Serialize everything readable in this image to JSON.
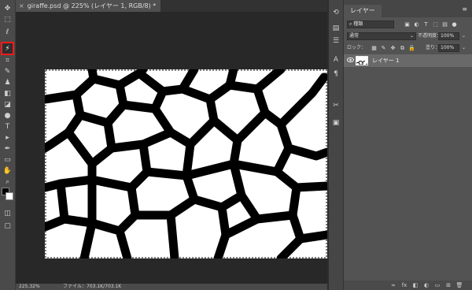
{
  "document": {
    "tab_close": "×",
    "tab_title": "giraffe.psd @ 225% (レイヤー 1, RGB/8) *"
  },
  "status": {
    "zoom": "225.32%",
    "file_info": "ファイル：703.1K/703.1K"
  },
  "tools": [
    {
      "name": "move-tool-icon",
      "glyph": "✥"
    },
    {
      "name": "marquee-tool-icon",
      "glyph": "⬚"
    },
    {
      "name": "lasso-tool-icon",
      "glyph": "ℓ"
    },
    {
      "name": "magic-wand-tool-icon",
      "glyph": "⚡"
    },
    {
      "name": "crop-tool-icon",
      "glyph": "⌗"
    },
    {
      "name": "brush-tool-icon",
      "glyph": "✎"
    },
    {
      "name": "stamp-tool-icon",
      "glyph": "♟"
    },
    {
      "name": "eraser-tool-icon",
      "glyph": "◧"
    },
    {
      "name": "bucket-tool-icon",
      "glyph": "◪"
    },
    {
      "name": "dodge-tool-icon",
      "glyph": "●"
    },
    {
      "name": "type-tool-icon",
      "glyph": "T"
    },
    {
      "name": "path-select-tool-icon",
      "glyph": "▸"
    },
    {
      "name": "pen-tool-icon",
      "glyph": "✒"
    },
    {
      "name": "shape-tool-icon",
      "glyph": "▭"
    },
    {
      "name": "hand-tool-icon",
      "glyph": "✋"
    },
    {
      "name": "zoom-tool-icon",
      "glyph": "⌕"
    },
    {
      "name": "more-tools-icon",
      "glyph": "…"
    }
  ],
  "panel_strip": [
    {
      "name": "history-panel-icon",
      "glyph": "⟲"
    },
    {
      "name": "channels-panel-icon",
      "glyph": "▤"
    },
    {
      "name": "adjust-panel-icon",
      "glyph": "☰"
    },
    {
      "name": "character-panel-icon",
      "glyph": "A"
    },
    {
      "name": "paragraph-panel-icon",
      "glyph": "¶"
    },
    {
      "name": "tools-preset-icon",
      "glyph": "✂"
    },
    {
      "name": "properties-panel-icon",
      "glyph": "▣"
    }
  ],
  "layers_panel": {
    "tab_label": "レイヤー",
    "menu_icon": "≡",
    "filter_kind": "種類",
    "filter_icons": [
      "▣",
      "◐",
      "T",
      "⬚",
      "▤",
      "●"
    ],
    "blend_mode": "通常",
    "opacity_label": "不透明度：",
    "opacity_value": "100%",
    "lock_label": "ロック：",
    "lock_icons": [
      "▦",
      "✎",
      "✥",
      "⧉",
      "🔒"
    ],
    "fill_label": "塗り：",
    "fill_value": "100%",
    "layers": [
      {
        "name": "レイヤー 1",
        "visible_icon": "👁"
      }
    ],
    "footer_icons": [
      "∞",
      "fx",
      "◧",
      "◐",
      "▭",
      "⊞",
      "🗑"
    ]
  },
  "colors": {
    "accent_red": "#ff1a1a",
    "foreground": "#000000",
    "background": "#ffffff"
  }
}
